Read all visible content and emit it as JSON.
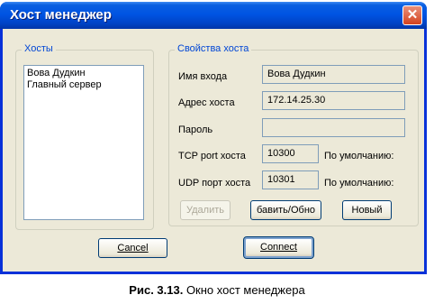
{
  "window": {
    "title": "Хост менеджер",
    "close_glyph": "✕"
  },
  "hosts": {
    "legend": "Хосты",
    "items": [
      "Вова Дудкин",
      "Главный сервер"
    ]
  },
  "props": {
    "legend": "Свойства хоста",
    "login_label": "Имя входа",
    "login_value": "Вова Дудкин",
    "address_label": "Адрес хоста",
    "address_value": "172.14.25.30",
    "password_label": "Пароль",
    "password_value": "",
    "tcp_label": "TCP port хоста",
    "tcp_value": "10300",
    "tcp_default": "По умолчанию:",
    "udp_label": "UDP порт хоста",
    "udp_value": "10301",
    "udp_default": "По умолчанию:",
    "delete_label": "Удалить",
    "add_update_label": "бавить/Обно",
    "new_label": "Новый"
  },
  "footer": {
    "cancel_label": "Cancel",
    "connect_label": "Connect"
  },
  "caption": {
    "bold": "Рис. 3.13.",
    "text": " Окно хост менеджера"
  }
}
